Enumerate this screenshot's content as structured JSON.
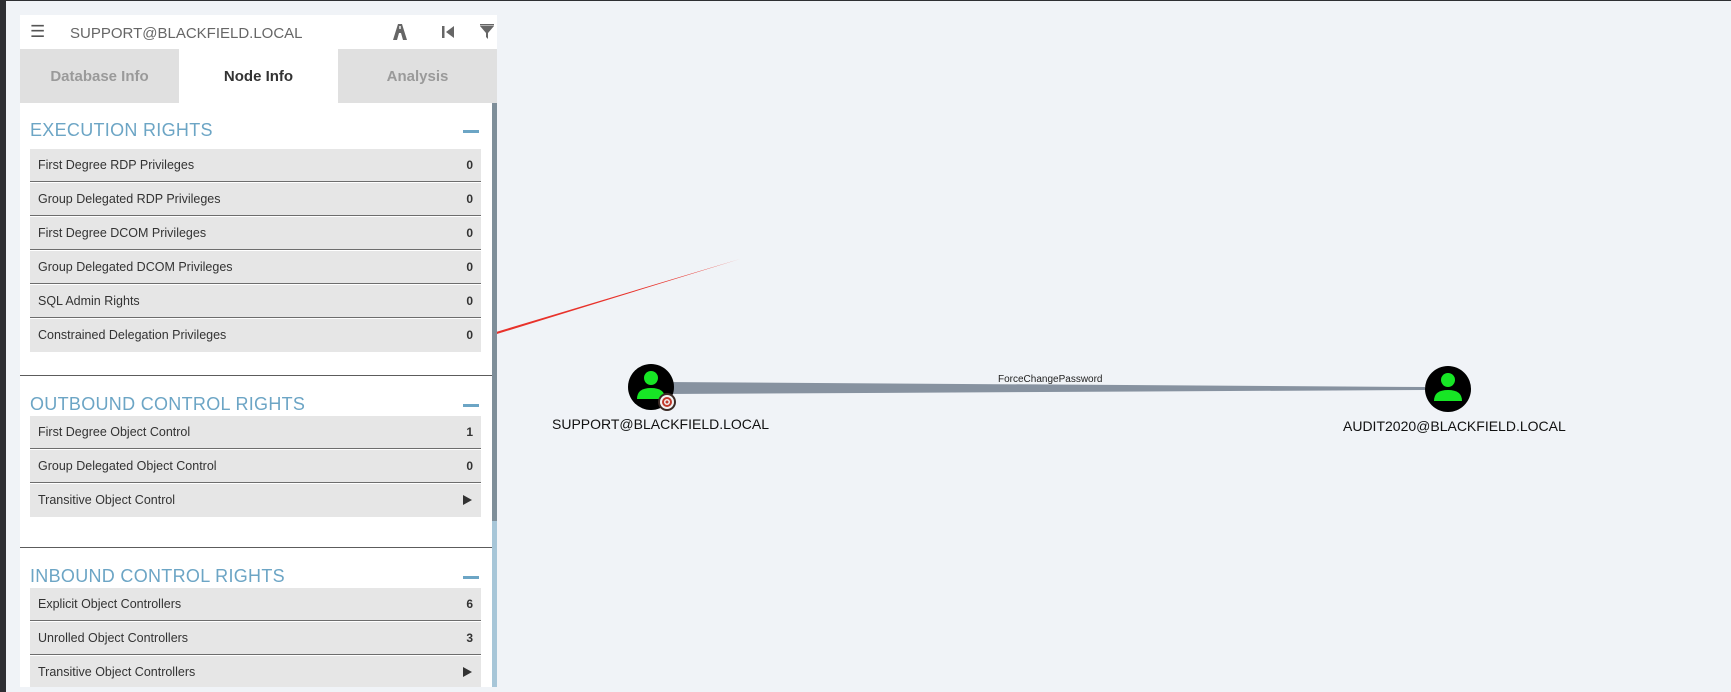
{
  "search": {
    "value": "SUPPORT@BLACKFIELD.LOCAL"
  },
  "toolbar": {
    "icons": [
      "pathfinding-icon",
      "back-icon",
      "filter-icon"
    ]
  },
  "tabs": [
    {
      "label": "Database Info"
    },
    {
      "label": "Node Info"
    },
    {
      "label": "Analysis"
    }
  ],
  "sections": {
    "execution": {
      "title": "EXECUTION RIGHTS",
      "rows": [
        {
          "label": "First Degree RDP Privileges",
          "value": "0"
        },
        {
          "label": "Group Delegated RDP Privileges",
          "value": "0"
        },
        {
          "label": "First Degree DCOM Privileges",
          "value": "0"
        },
        {
          "label": "Group Delegated DCOM Privileges",
          "value": "0"
        },
        {
          "label": "SQL Admin Rights",
          "value": "0"
        },
        {
          "label": "Constrained Delegation Privileges",
          "value": "0"
        }
      ]
    },
    "outbound": {
      "title": "OUTBOUND CONTROL RIGHTS",
      "rows": [
        {
          "label": "First Degree Object Control",
          "value": "1"
        },
        {
          "label": "Group Delegated Object Control",
          "value": "0"
        },
        {
          "label": "Transitive Object Control",
          "value": ""
        }
      ]
    },
    "inbound": {
      "title": "INBOUND CONTROL RIGHTS",
      "rows": [
        {
          "label": "Explicit Object Controllers",
          "value": "6"
        },
        {
          "label": "Unrolled Object Controllers",
          "value": "3"
        },
        {
          "label": "Transitive Object Controllers",
          "value": ""
        }
      ]
    }
  },
  "graph": {
    "source_node": "SUPPORT@BLACKFIELD.LOCAL",
    "target_node": "AUDIT2020@BLACKFIELD.LOCAL",
    "edge_label": "ForceChangePassword"
  },
  "colors": {
    "section_title": "#6ca5c5",
    "node_fill": "#17e625",
    "annotation_arrow": "#e8322b"
  }
}
